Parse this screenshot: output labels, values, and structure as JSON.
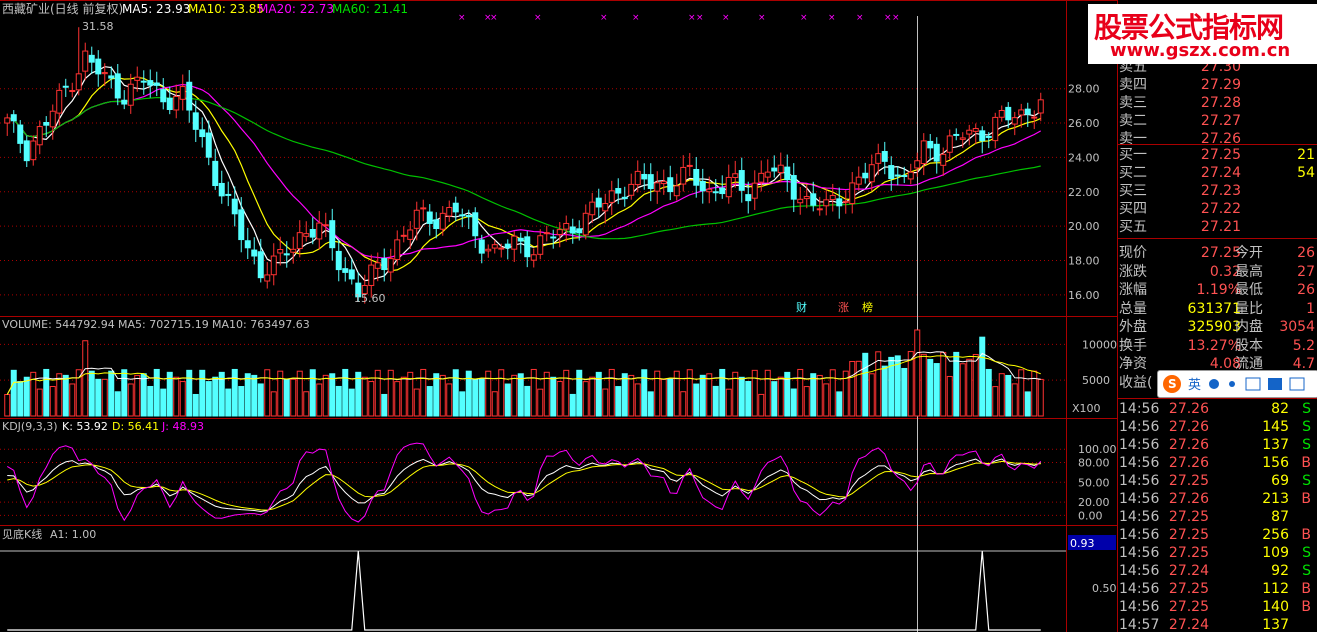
{
  "colors": {
    "up": "#ff3232",
    "down": "#54ffff",
    "ma5": "#ffffff",
    "ma10": "#ffff00",
    "ma20": "#ff00ff",
    "ma60": "#00c000",
    "grid": "#aa0000",
    "text": "#c0c0c0",
    "valueRed": "#ff5252",
    "green": "#00e000"
  },
  "header": {
    "title": "西藏矿业(日线 前复权)",
    "ma5_label": "MA5: 23.93",
    "ma10_label": "MA10: 23.85",
    "ma20_label": "MA20: 22.73",
    "ma60_label": "MA60: 21.41"
  },
  "price_panel": {
    "high_annotation": "31.58",
    "low_annotation": "15.60",
    "yticks": [
      "28.00",
      "26.00",
      "24.00",
      "22.00",
      "20.00",
      "18.00",
      "16.00"
    ],
    "markers": [
      "财",
      "涨",
      "榜"
    ]
  },
  "volume_panel": {
    "label": "VOLUME: 544792.94",
    "ma5_label": "MA5: 702715.19",
    "ma10_label": "MA10: 763497.63",
    "yticks": [
      "10000",
      "5000"
    ],
    "unit": "X100"
  },
  "kdj_panel": {
    "label": "KDJ(9,3,3)",
    "k_label": "K: 53.92",
    "d_label": "D: 56.41",
    "j_label": "J: 48.93",
    "yticks": [
      "100.00",
      "80.00",
      "50.00",
      "20.00",
      "0.00"
    ]
  },
  "signal_panel": {
    "label": "见底K线",
    "a1_label": "A1: 1.00",
    "value_box": "0.93",
    "ytick": "0.50"
  },
  "watermark": {
    "line1": "股票公式指标网",
    "line2": "www.gszx.com.cn"
  },
  "order_book": {
    "asks": [
      {
        "label": "卖五",
        "price": "27.30"
      },
      {
        "label": "卖四",
        "price": "27.29"
      },
      {
        "label": "卖三",
        "price": "27.28"
      },
      {
        "label": "卖二",
        "price": "27.27"
      },
      {
        "label": "卖一",
        "price": "27.26"
      }
    ],
    "bids": [
      {
        "label": "买一",
        "price": "27.25",
        "vol": "21"
      },
      {
        "label": "买二",
        "price": "27.24",
        "vol": "54"
      },
      {
        "label": "买三",
        "price": "27.23",
        "vol": ""
      },
      {
        "label": "买四",
        "price": "27.22",
        "vol": ""
      },
      {
        "label": "买五",
        "price": "27.21",
        "vol": ""
      }
    ]
  },
  "quote": {
    "rows": [
      {
        "l1": "现价",
        "v1": "27.25",
        "l2": "今开",
        "v2": "26"
      },
      {
        "l1": "涨跌",
        "v1": "0.32",
        "l2": "最高",
        "v2": "27"
      },
      {
        "l1": "涨幅",
        "v1": "1.19%",
        "l2": "最低",
        "v2": "26"
      },
      {
        "l1": "总量",
        "v1": "631371",
        "l2": "量比",
        "v2": "1"
      },
      {
        "l1": "外盘",
        "v1": "325903",
        "l2": "内盘",
        "v2": "3054"
      },
      {
        "l1": "换手",
        "v1": "13.27%",
        "l2": "股本",
        "v2": "5.2"
      },
      {
        "l1": "净资",
        "v1": "4.08",
        "l2": "流通",
        "v2": "4.7"
      },
      {
        "l1": "收益(",
        "v1": "",
        "l2": "",
        "v2": ""
      }
    ]
  },
  "ticks": [
    {
      "time": "14:56",
      "price": "27.26",
      "vol": "82",
      "side": "S"
    },
    {
      "time": "14:56",
      "price": "27.26",
      "vol": "145",
      "side": "S"
    },
    {
      "time": "14:56",
      "price": "27.26",
      "vol": "137",
      "side": "S"
    },
    {
      "time": "14:56",
      "price": "27.26",
      "vol": "156",
      "side": "B"
    },
    {
      "time": "14:56",
      "price": "27.25",
      "vol": "69",
      "side": "S"
    },
    {
      "time": "14:56",
      "price": "27.26",
      "vol": "213",
      "side": "B"
    },
    {
      "time": "14:56",
      "price": "27.25",
      "vol": "87",
      "side": ""
    },
    {
      "time": "14:56",
      "price": "27.25",
      "vol": "256",
      "side": "B"
    },
    {
      "time": "14:56",
      "price": "27.25",
      "vol": "109",
      "side": "S"
    },
    {
      "time": "14:56",
      "price": "27.24",
      "vol": "92",
      "side": "S"
    },
    {
      "time": "14:56",
      "price": "27.25",
      "vol": "112",
      "side": "B"
    },
    {
      "time": "14:56",
      "price": "27.25",
      "vol": "140",
      "side": "B"
    },
    {
      "time": "14:57",
      "price": "27.24",
      "vol": "137",
      "side": ""
    }
  ],
  "chart_data": [
    {
      "type": "candlestick",
      "title": "西藏矿业(日线 前复权)",
      "ylim": [
        15,
        32
      ],
      "anchors": [
        [
          0,
          26
        ],
        [
          3,
          24.5
        ],
        [
          6,
          26
        ],
        [
          9,
          28
        ],
        [
          12,
          29.8
        ],
        [
          15,
          28.6
        ],
        [
          18,
          27.7
        ],
        [
          21,
          28.5
        ],
        [
          24,
          27.5
        ],
        [
          27,
          27.5
        ],
        [
          30,
          25
        ],
        [
          33,
          22
        ],
        [
          36,
          19.5
        ],
        [
          39,
          17.4
        ],
        [
          42,
          18
        ],
        [
          45,
          19.5
        ],
        [
          48,
          20
        ],
        [
          51,
          18
        ],
        [
          54,
          16.2
        ],
        [
          57,
          17.5
        ],
        [
          60,
          19
        ],
        [
          63,
          20.5
        ],
        [
          66,
          20.5
        ],
        [
          69,
          21
        ],
        [
          72,
          19.5
        ],
        [
          75,
          18.5
        ],
        [
          78,
          19
        ],
        [
          81,
          18.8
        ],
        [
          84,
          19.5
        ],
        [
          87,
          20
        ],
        [
          90,
          20.8
        ],
        [
          93,
          21.8
        ],
        [
          96,
          22.5
        ],
        [
          99,
          22.5
        ],
        [
          102,
          22.5
        ],
        [
          105,
          23
        ],
        [
          108,
          22
        ],
        [
          111,
          22.5
        ],
        [
          114,
          22
        ],
        [
          117,
          23.5
        ],
        [
          120,
          22.5
        ],
        [
          123,
          21.5
        ],
        [
          126,
          21
        ],
        [
          129,
          22
        ],
        [
          132,
          23
        ],
        [
          135,
          24
        ],
        [
          138,
          22.5
        ],
        [
          141,
          24.5
        ],
        [
          144,
          24.5
        ],
        [
          147,
          25.3
        ],
        [
          150,
          25.5
        ],
        [
          153,
          26.2
        ],
        [
          156,
          26.5
        ],
        [
          159,
          27.25
        ]
      ],
      "high_label": "31.58",
      "low_label": "15.60"
    },
    {
      "type": "bar",
      "name": "VOLUME",
      "ylim": [
        0,
        12000
      ]
    },
    {
      "type": "line",
      "name": "KDJ(9,3,3)",
      "k": 53.92,
      "d": 56.41,
      "j": 48.93,
      "ylim": [
        -10,
        120
      ]
    },
    {
      "type": "line",
      "name": "见底K线",
      "a1": 1.0,
      "spikes": [
        54,
        150
      ]
    }
  ]
}
